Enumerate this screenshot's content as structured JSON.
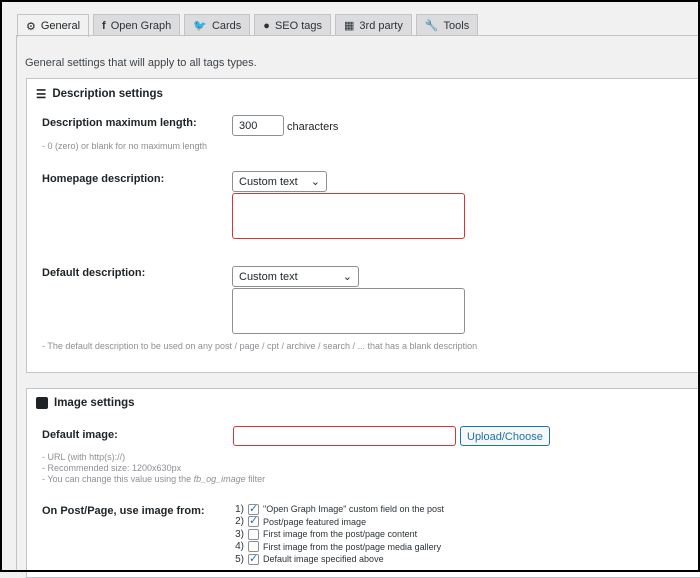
{
  "tabs": [
    {
      "label": "General",
      "icon": "gear-icon"
    },
    {
      "label": "Open Graph",
      "icon": "facebook-icon"
    },
    {
      "label": "Cards",
      "icon": "twitter-icon"
    },
    {
      "label": "SEO tags",
      "icon": "globe-icon"
    },
    {
      "label": "3rd party",
      "icon": "building-icon"
    },
    {
      "label": "Tools",
      "icon": "wrench-icon"
    }
  ],
  "intro": "General settings that will apply to all tags types.",
  "description": {
    "title": "Description settings",
    "max_length_label": "Description maximum length:",
    "max_length_value": "300",
    "max_length_unit": "characters",
    "max_length_help": "- 0 (zero) or blank for no maximum length",
    "homepage_label": "Homepage description:",
    "homepage_select": "Custom text",
    "homepage_text": "",
    "default_label": "Default description:",
    "default_select": "Custom text",
    "default_text": "",
    "default_help": "- The default description to be used on any post / page / cpt / archive / search / ... that has a blank description"
  },
  "image": {
    "title": "Image settings",
    "default_label": "Default image:",
    "default_value": "",
    "upload_button": "Upload/Choose",
    "help1": "- URL (with http(s)://)",
    "help2": "- Recommended size: 1200x630px",
    "help3_pre": "- You can change this value using the ",
    "help3_code": "fb_og_image",
    "help3_post": " filter",
    "use_from_label": "On Post/Page, use image from:",
    "options": [
      {
        "num": "1)",
        "label": "\"Open Graph Image\" custom field on the post",
        "checked": true
      },
      {
        "num": "2)",
        "label": "Post/page featured image",
        "checked": true
      },
      {
        "num": "3)",
        "label": "First image from the post/page content",
        "checked": false
      },
      {
        "num": "4)",
        "label": "First image from the post/page media gallery",
        "checked": false
      },
      {
        "num": "5)",
        "label": "Default image specified above",
        "checked": true
      }
    ]
  }
}
